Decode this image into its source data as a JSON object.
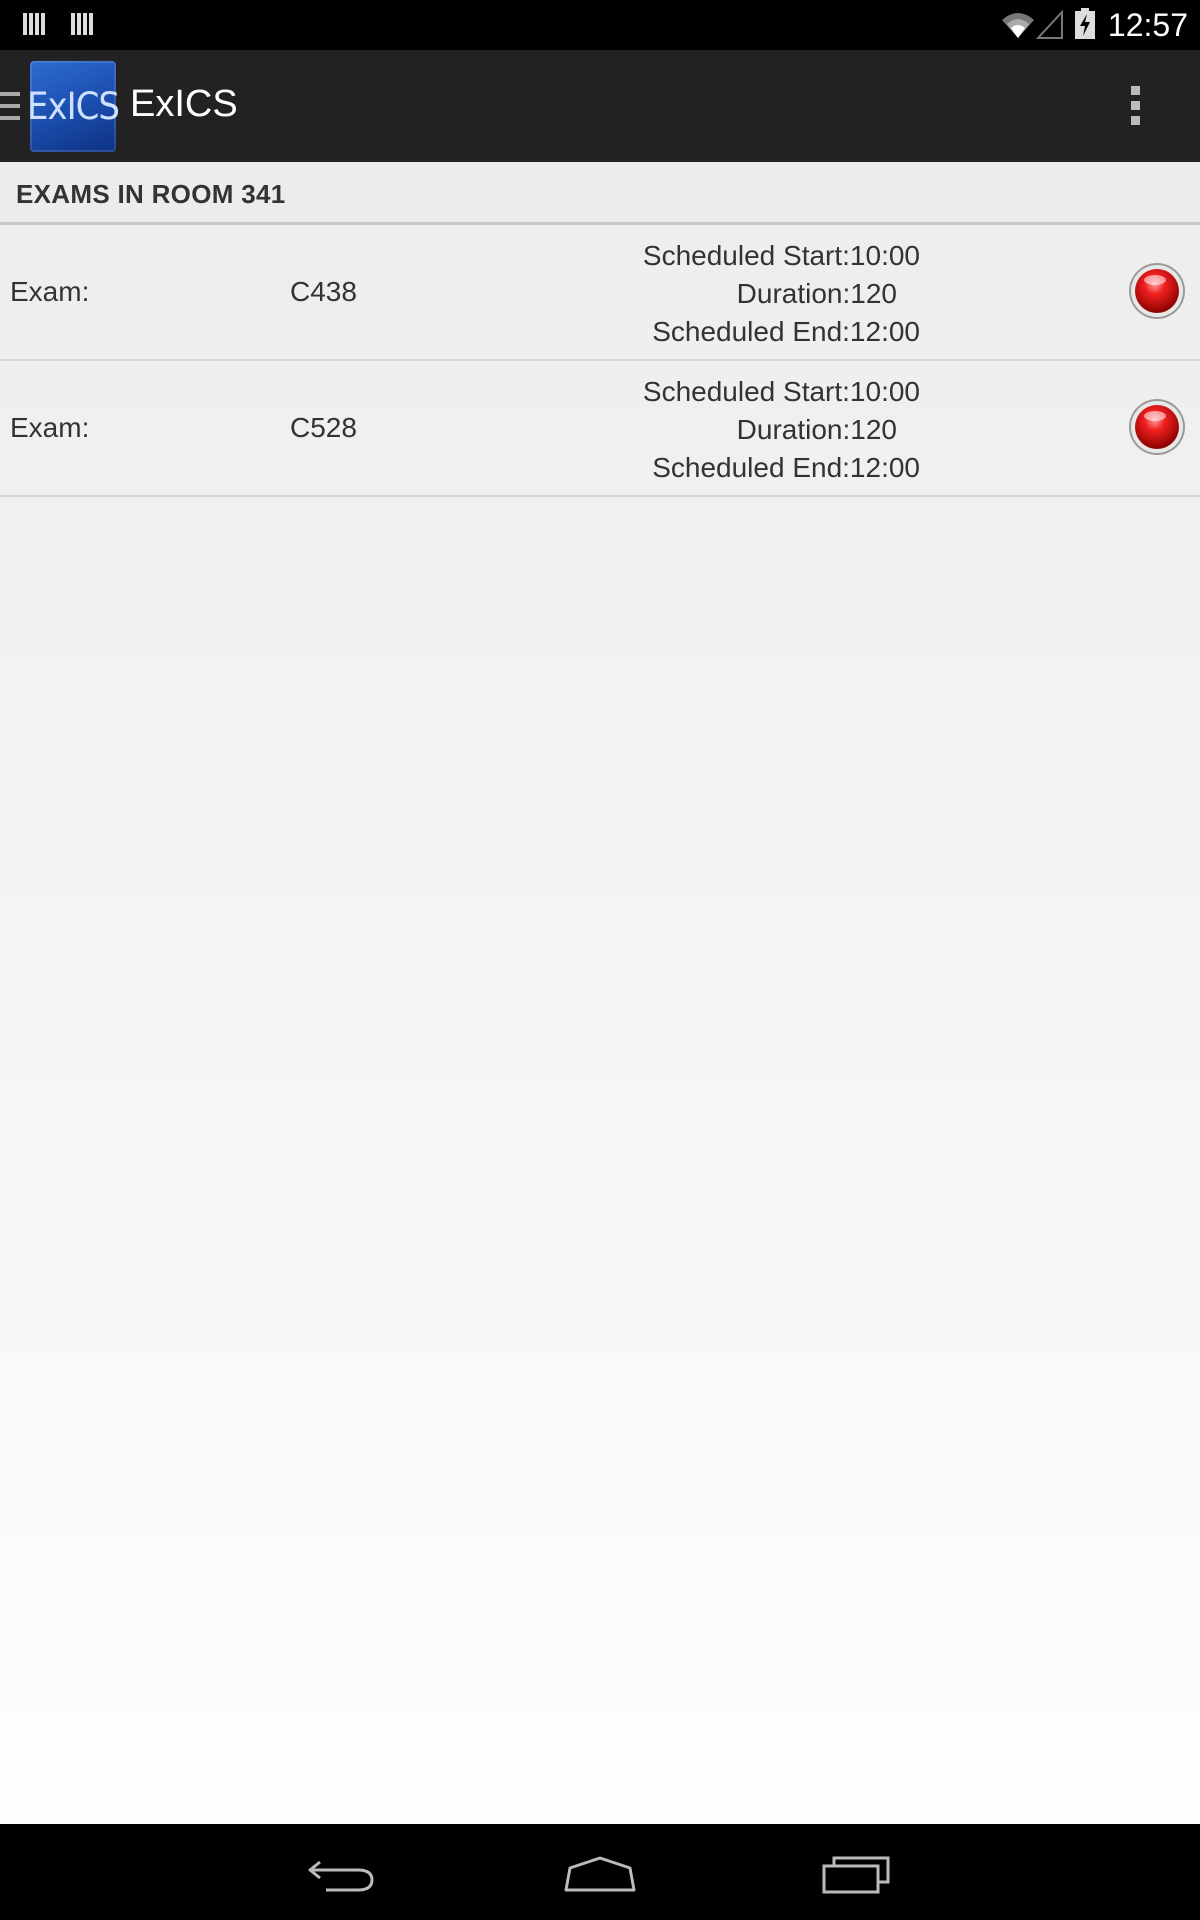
{
  "status_bar": {
    "time": "12:57",
    "icons": [
      "notification-bars-icon",
      "notification-bars-icon",
      "wifi-icon",
      "signal-icon",
      "battery-charging-icon"
    ]
  },
  "action_bar": {
    "title": "ExICS",
    "logo_text": "ExICS",
    "logo_color": "#1c4fb0"
  },
  "section": {
    "title": "EXAMS IN ROOM 341"
  },
  "exams": [
    {
      "label": "Exam:",
      "code": "C438",
      "scheduled_start": "Scheduled Start:10:00",
      "duration": "Duration:120",
      "scheduled_end": "Scheduled End:12:00",
      "status_color": "#e01818"
    },
    {
      "label": "Exam:",
      "code": "C528",
      "scheduled_start": "Scheduled Start:10:00",
      "duration": "Duration:120",
      "scheduled_end": "Scheduled End:12:00",
      "status_color": "#e01818"
    }
  ],
  "nav_bar": {
    "icons": [
      "back-icon",
      "home-icon",
      "recents-icon"
    ]
  }
}
